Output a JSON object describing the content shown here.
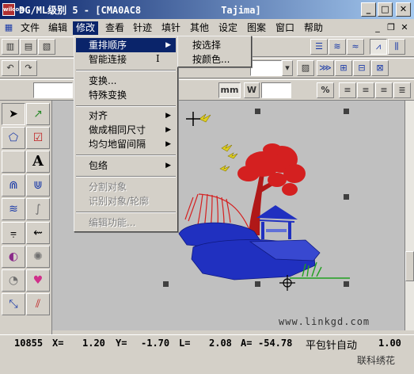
{
  "window": {
    "title": "DG/ML级别 5 - [CMA0AC8              Tajima]",
    "logo_text": "wilcom"
  },
  "menubar": {
    "items": [
      {
        "label": "文件"
      },
      {
        "label": "编辑"
      },
      {
        "label": "修改",
        "active": true
      },
      {
        "label": "查看"
      },
      {
        "label": "针迹"
      },
      {
        "label": "填针"
      },
      {
        "label": "其他"
      },
      {
        "label": "设定"
      },
      {
        "label": "图案"
      },
      {
        "label": "窗口"
      },
      {
        "label": "帮助"
      }
    ]
  },
  "toolbar": {
    "unit_mm": "mm",
    "w_label": "W",
    "percent": "%"
  },
  "modify_menu": {
    "items": [
      {
        "label": "重排顺序",
        "submenu": true,
        "highlighted": true
      },
      {
        "label": "智能连接"
      },
      {
        "label": "变换..."
      },
      {
        "label": "特殊变换"
      },
      {
        "label": "对齐",
        "submenu": true
      },
      {
        "label": "做成相同尺寸",
        "submenu": true
      },
      {
        "label": "均匀地留间隔",
        "submenu": true
      },
      {
        "label": "包络",
        "submenu": true
      },
      {
        "label": "分割对象",
        "disabled": true
      },
      {
        "label": "识别对象/轮廓",
        "disabled": true
      },
      {
        "label": "编辑功能...",
        "disabled": true
      }
    ]
  },
  "reorder_submenu": {
    "items": [
      {
        "label": "按选择"
      },
      {
        "label": "按颜色..."
      }
    ]
  },
  "cursor_glyph": "I",
  "canvas": {
    "url_text": "www.linkgd.com"
  },
  "statusbar": {
    "stitch_count": "10855",
    "x_label": "X=",
    "x_value": "1.20",
    "y_label": "Y=",
    "y_value": "-1.70",
    "l_label": "L=",
    "l_value": "2.08",
    "a_label": "A=",
    "a_value": "-54.78",
    "mode": "平包针自动",
    "zoom": "1.00"
  },
  "watermark_small": "联科绣花",
  "colors": {
    "title_active": "#0a246a",
    "menu_highlight": "#0a246a",
    "canvas_bg": "#c0c0c0",
    "tree_red": "#d42020",
    "rock_blue": "#2030c0",
    "grass_green": "#20a020",
    "bird_yellow": "#e0d020"
  }
}
